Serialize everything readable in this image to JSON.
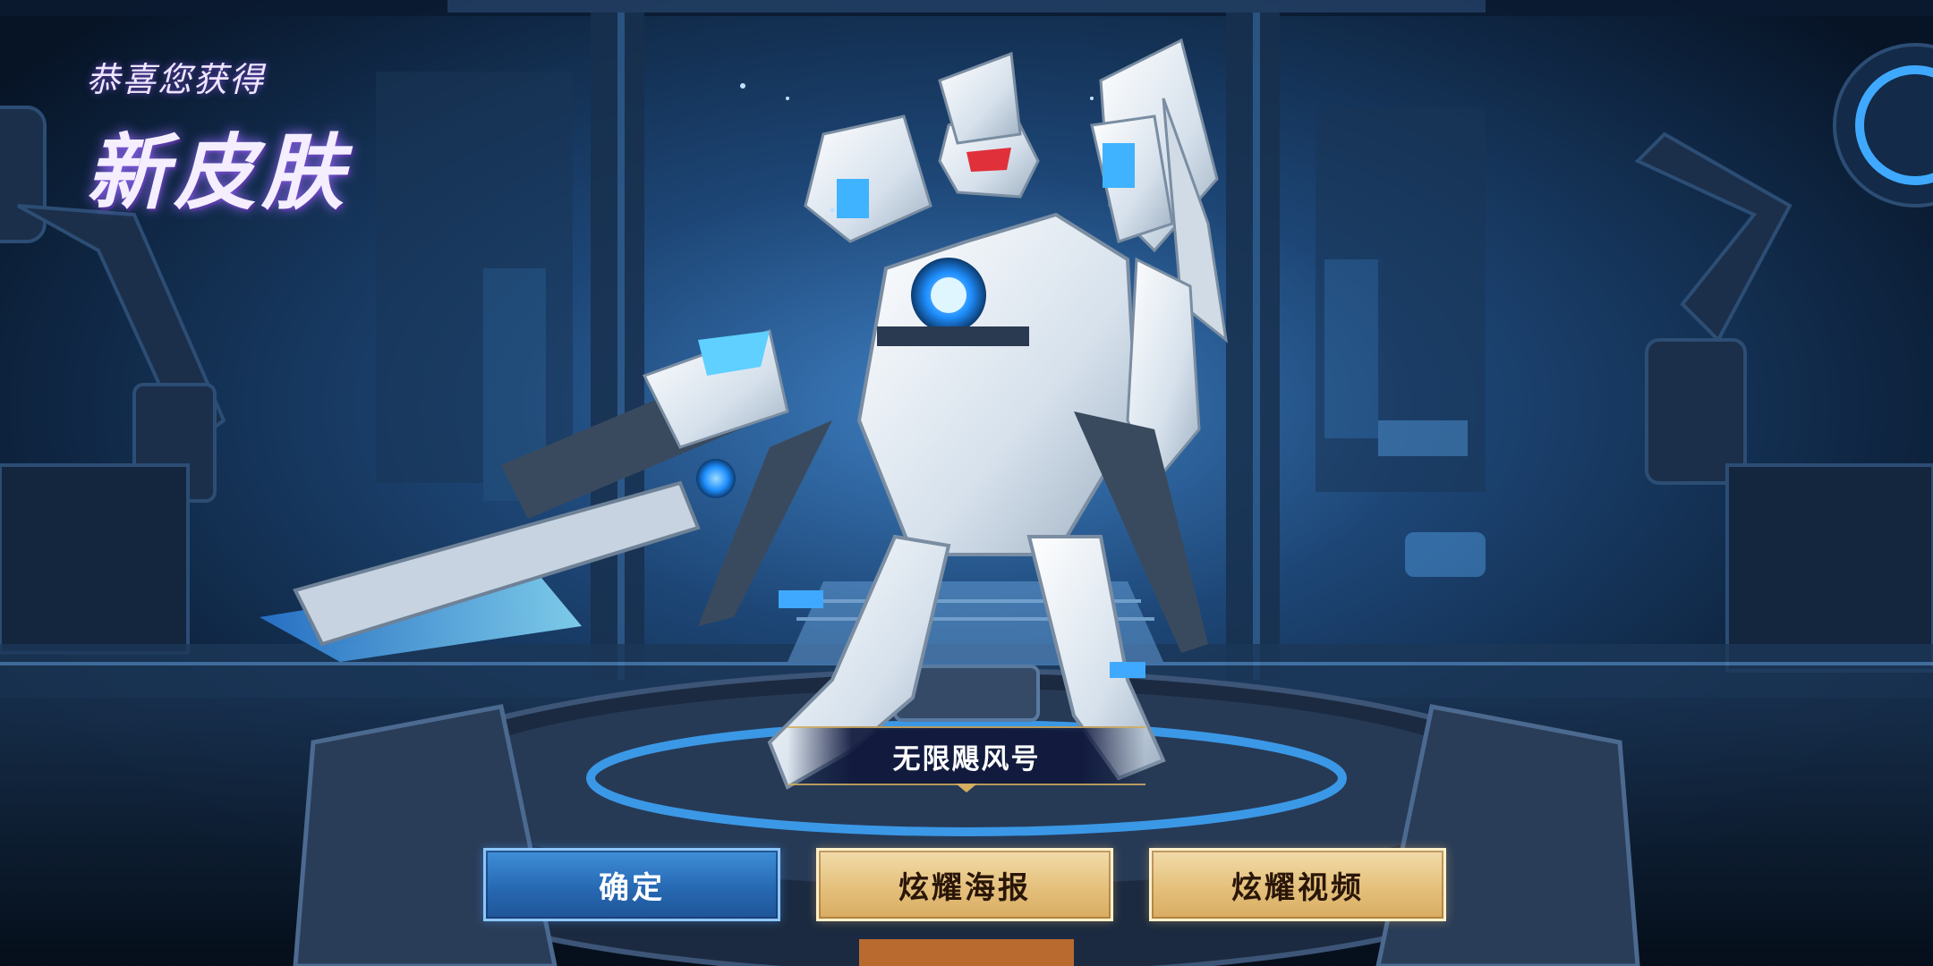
{
  "header": {
    "subtitle": "恭喜您获得",
    "title": "新皮肤"
  },
  "skin": {
    "name": "无限飓风号"
  },
  "buttons": {
    "confirm_label": "确定",
    "poster_label": "炫耀海报",
    "video_label": "炫耀视频"
  },
  "colors": {
    "background": "#0e2744",
    "accent_blue": "#3fa9ff",
    "gold": "#d4ae60",
    "title_glow": "#9a6eff"
  }
}
